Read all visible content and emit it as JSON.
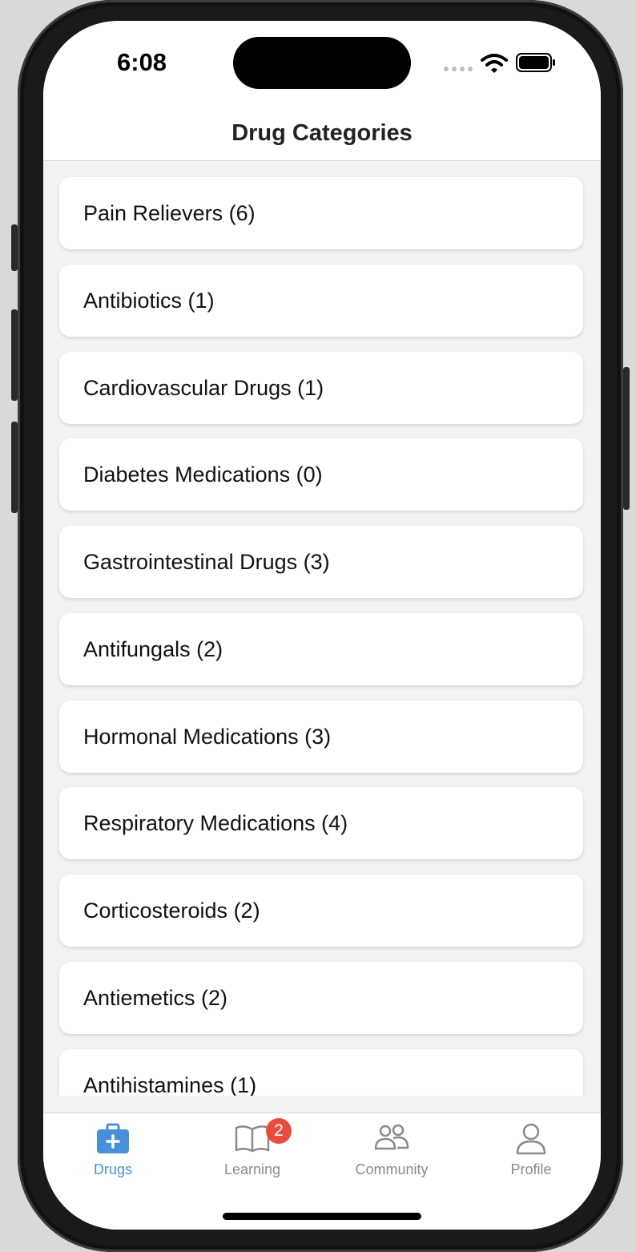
{
  "status_bar": {
    "time": "6:08"
  },
  "header": {
    "title": "Drug Categories"
  },
  "categories": [
    {
      "label": "Pain Relievers (6)"
    },
    {
      "label": "Antibiotics (1)"
    },
    {
      "label": "Cardiovascular Drugs (1)"
    },
    {
      "label": "Diabetes Medications (0)"
    },
    {
      "label": "Gastrointestinal Drugs (3)"
    },
    {
      "label": "Antifungals (2)"
    },
    {
      "label": "Hormonal Medications (3)"
    },
    {
      "label": "Respiratory Medications (4)"
    },
    {
      "label": "Corticosteroids (2)"
    },
    {
      "label": "Antiemetics (2)"
    },
    {
      "label": "Antihistamines (1)"
    }
  ],
  "tabbar": {
    "tabs": [
      {
        "label": "Drugs",
        "icon": "medical-kit-icon",
        "active": true
      },
      {
        "label": "Learning",
        "icon": "book-icon",
        "badge": "2"
      },
      {
        "label": "Community",
        "icon": "people-icon"
      },
      {
        "label": "Profile",
        "icon": "person-icon"
      }
    ]
  },
  "colors": {
    "accent": "#4a90d9",
    "badge": "#e74c3c",
    "background": "#f2f2f2"
  }
}
